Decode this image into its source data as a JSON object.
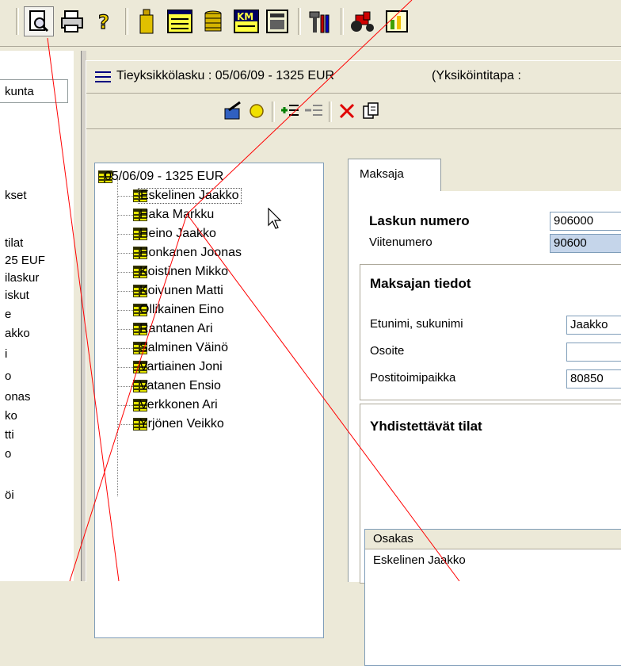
{
  "toolbar": {
    "buttons": [
      {
        "name": "print-preview-icon",
        "glyph": "🔍"
      },
      {
        "name": "print-icon",
        "glyph": "🖶"
      },
      {
        "name": "help-icon",
        "glyph": "?"
      },
      {
        "name": "bottle-icon",
        "glyph": "▮"
      },
      {
        "name": "document-list-icon",
        "glyph": "≡"
      },
      {
        "name": "coins-icon",
        "glyph": "⛁"
      },
      {
        "name": "km-icon",
        "glyph": "KM"
      },
      {
        "name": "calculator-icon",
        "glyph": "▦"
      },
      {
        "name": "tools-icon",
        "glyph": "⚒"
      },
      {
        "name": "tractor-icon",
        "glyph": "🚜"
      },
      {
        "name": "chart-icon",
        "glyph": "▤"
      }
    ]
  },
  "left_panel": {
    "tab_label": "kunta",
    "items": [
      "kset",
      "tilat",
      "25 EUF",
      "ilaskur",
      "iskut",
      "e",
      "akko",
      "i",
      "o",
      "onas",
      "ko",
      "tti",
      "o",
      "öi"
    ]
  },
  "window": {
    "title": "Tieyksikkölasku : 05/06/09 - 1325 EUR",
    "title_extra": "(Yksiköintitapa :",
    "subtoolbar": [
      {
        "name": "edit-icon"
      },
      {
        "name": "circle-icon"
      },
      {
        "name": "add-row-icon"
      },
      {
        "name": "remove-row-icon"
      },
      {
        "name": "delete-icon"
      },
      {
        "name": "copy-icon"
      }
    ]
  },
  "tree": {
    "root": "05/06/09 - 1325 EUR",
    "children": [
      "Eskelinen Jaakko",
      "Haka Markku",
      "Heino Jaakko",
      "Honkanen Joonas",
      "Koistinen Mikko",
      "Koivunen Matti",
      "Ollikainen Eino",
      "Rantanen Ari",
      "Salminen Väinö",
      "Vartiainen Joni",
      "Vatanen Ensio",
      "Verkkonen Ari",
      "Yrjönen Veikko"
    ]
  },
  "tab": {
    "label": "Maksaja"
  },
  "invoice": {
    "number_label": "Laskun numero",
    "number_value": "906000",
    "ref_label": "Viitenumero",
    "ref_value": "90600"
  },
  "payer": {
    "heading": "Maksajan tiedot",
    "name_label": "Etunimi, sukunimi",
    "name_value": "Jaakko",
    "address_label": "Osoite",
    "address_value": "",
    "postal_label": "Postitoimipaikka",
    "postal_value": "80850"
  },
  "merge": {
    "heading": "Yhdistettävät tilat",
    "column": "Osakas",
    "rows": [
      "Eskelinen Jaakko"
    ]
  },
  "colors": {
    "accent_line": "#ff0000",
    "node_icon": "#3a3a00",
    "node_icon_fill": "#e8e800"
  }
}
